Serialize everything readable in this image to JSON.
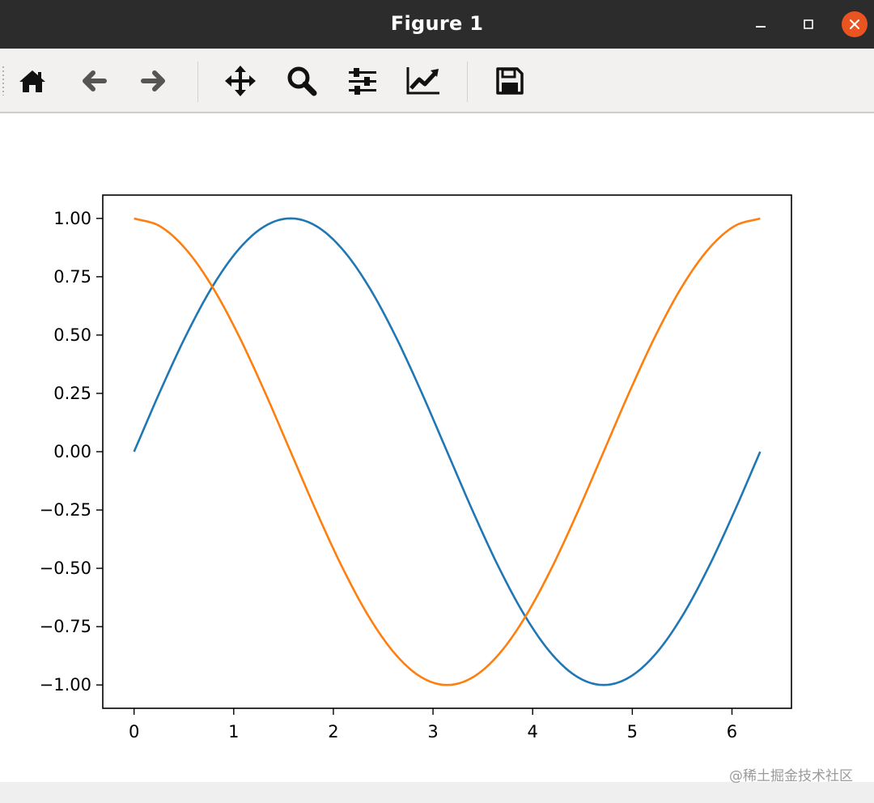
{
  "window": {
    "title": "Figure 1"
  },
  "toolbar": {
    "buttons": [
      {
        "name": "home",
        "icon": "home-icon"
      },
      {
        "name": "back",
        "icon": "arrow-left-icon"
      },
      {
        "name": "forward",
        "icon": "arrow-right-icon"
      },
      {
        "name": "pan",
        "icon": "move-icon"
      },
      {
        "name": "zoom",
        "icon": "zoom-icon"
      },
      {
        "name": "subplots",
        "icon": "sliders-icon"
      },
      {
        "name": "edit-axis",
        "icon": "line-chart-icon"
      },
      {
        "name": "save",
        "icon": "save-icon"
      }
    ]
  },
  "colors": {
    "titlebar": "#2c2c2c",
    "close_button": "#e95420",
    "toolbar": "#f2f1f0",
    "series_sin": "#1f77b4",
    "series_cos": "#ff7f0e"
  },
  "watermark": "@稀土掘金技术社区",
  "chart_data": {
    "type": "line",
    "title": "",
    "xlabel": "",
    "ylabel": "",
    "xlim": [
      -0.314,
      6.597
    ],
    "ylim": [
      -1.1,
      1.1
    ],
    "x_ticks": [
      0,
      1,
      2,
      3,
      4,
      5,
      6
    ],
    "x_tick_labels": [
      "0",
      "1",
      "2",
      "3",
      "4",
      "5",
      "6"
    ],
    "y_ticks": [
      1.0,
      0.75,
      0.5,
      0.25,
      0.0,
      -0.25,
      -0.5,
      -0.75,
      -1.0
    ],
    "y_tick_labels": [
      "1.00",
      "0.75",
      "0.50",
      "0.25",
      "0.00",
      "−0.25",
      "−0.50",
      "−0.75",
      "−1.00"
    ],
    "grid": false,
    "legend": "none",
    "series": [
      {
        "color": "#1f77b4",
        "x": [
          0,
          0.2618,
          0.5236,
          0.7854,
          1.0472,
          1.309,
          1.5708,
          1.8326,
          2.0944,
          2.3562,
          2.618,
          2.8798,
          3.1416,
          3.4034,
          3.6652,
          3.927,
          4.1888,
          4.4506,
          4.7124,
          4.9742,
          5.236,
          5.4978,
          5.7596,
          6.0214,
          6.2832
        ],
        "y": [
          0,
          0.259,
          0.5,
          0.707,
          0.866,
          0.966,
          1.0,
          0.966,
          0.866,
          0.707,
          0.5,
          0.259,
          0,
          -0.259,
          -0.5,
          -0.707,
          -0.866,
          -0.966,
          -1.0,
          -0.966,
          -0.866,
          -0.707,
          -0.5,
          -0.259,
          0
        ]
      },
      {
        "color": "#ff7f0e",
        "x": [
          0,
          0.2618,
          0.5236,
          0.7854,
          1.0472,
          1.309,
          1.5708,
          1.8326,
          2.0944,
          2.3562,
          2.618,
          2.8798,
          3.1416,
          3.4034,
          3.6652,
          3.927,
          4.1888,
          4.4506,
          4.7124,
          4.9742,
          5.236,
          5.4978,
          5.7596,
          6.0214,
          6.2832
        ],
        "y": [
          1.0,
          0.966,
          0.866,
          0.707,
          0.5,
          0.259,
          0,
          -0.259,
          -0.5,
          -0.707,
          -0.866,
          -0.966,
          -1.0,
          -0.966,
          -0.866,
          -0.707,
          -0.5,
          -0.259,
          0,
          0.259,
          0.5,
          0.707,
          0.866,
          0.966,
          1.0
        ]
      }
    ]
  }
}
